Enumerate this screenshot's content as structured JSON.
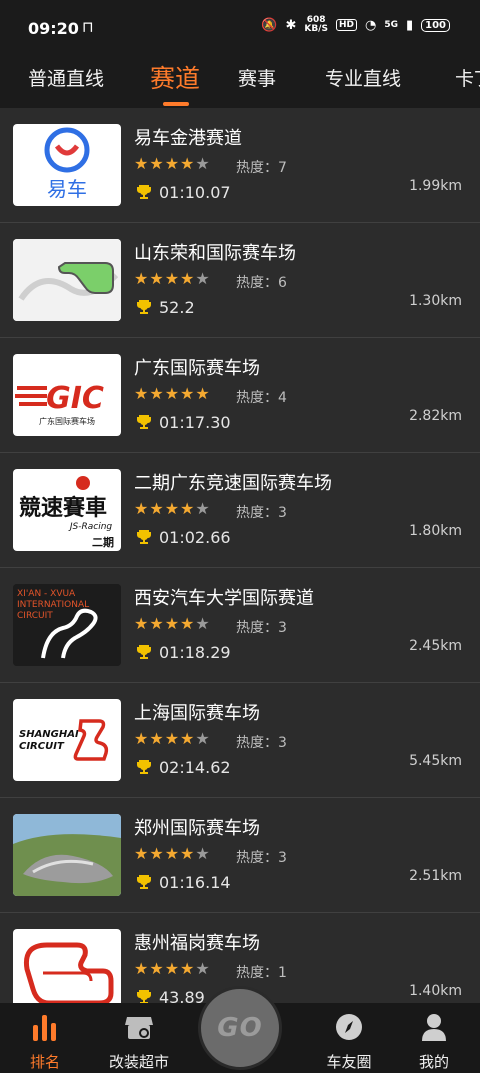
{
  "status": {
    "time": "09:20",
    "net_speed_value": "608",
    "net_speed_unit": "KB/S",
    "hd": "HD",
    "signal": "5G",
    "battery": "100"
  },
  "tabs": [
    {
      "label": "普通直线"
    },
    {
      "label": "赛道"
    },
    {
      "label": "赛事"
    },
    {
      "label": "专业直线"
    },
    {
      "label": "卡丁"
    }
  ],
  "heat_prefix": "热度：",
  "tracks": [
    {
      "name": "易车金港赛道",
      "rating": 4,
      "heat": "7",
      "time": "01:10.07",
      "distance": "1.99km",
      "logo_text": "易车"
    },
    {
      "name": "山东荣和国际赛车场",
      "rating": 4,
      "heat": "6",
      "time": "52.2",
      "distance": "1.30km"
    },
    {
      "name": "广东国际赛车场",
      "rating": 5,
      "heat": "4",
      "time": "01:17.30",
      "distance": "2.82km",
      "logo_text": "GIC",
      "logo_sub": "广东国际赛车场"
    },
    {
      "name": "二期广东竞速国际赛车场",
      "rating": 4,
      "heat": "3",
      "time": "01:02.66",
      "distance": "1.80km",
      "logo_text": "競速賽車",
      "logo_sub": "JS-Racing",
      "logo_tag": "二期"
    },
    {
      "name": "西安汽车大学国际赛道",
      "rating": 4,
      "heat": "3",
      "time": "01:18.29",
      "distance": "2.45km",
      "logo_text": "XI'AN - XVUA",
      "logo_sub": "INTERNATIONAL",
      "logo_tag": "CIRCUIT"
    },
    {
      "name": "上海国际赛车场",
      "rating": 4,
      "heat": "3",
      "time": "02:14.62",
      "distance": "5.45km",
      "logo_text": "SHANGHAI",
      "logo_sub": "CIRCUIT"
    },
    {
      "name": "郑州国际赛车场",
      "rating": 4,
      "heat": "3",
      "time": "01:16.14",
      "distance": "2.51km"
    },
    {
      "name": "惠州福岗赛车场",
      "rating": 4,
      "heat": "1",
      "time": "43.89",
      "distance": "1.40km"
    }
  ],
  "nav": {
    "ranking": "排名",
    "mod_market": "改装超市",
    "go": "GO",
    "friends": "车友圈",
    "mine": "我的"
  },
  "colors": {
    "accent": "#ff7b2b",
    "star": "#f4a931"
  }
}
